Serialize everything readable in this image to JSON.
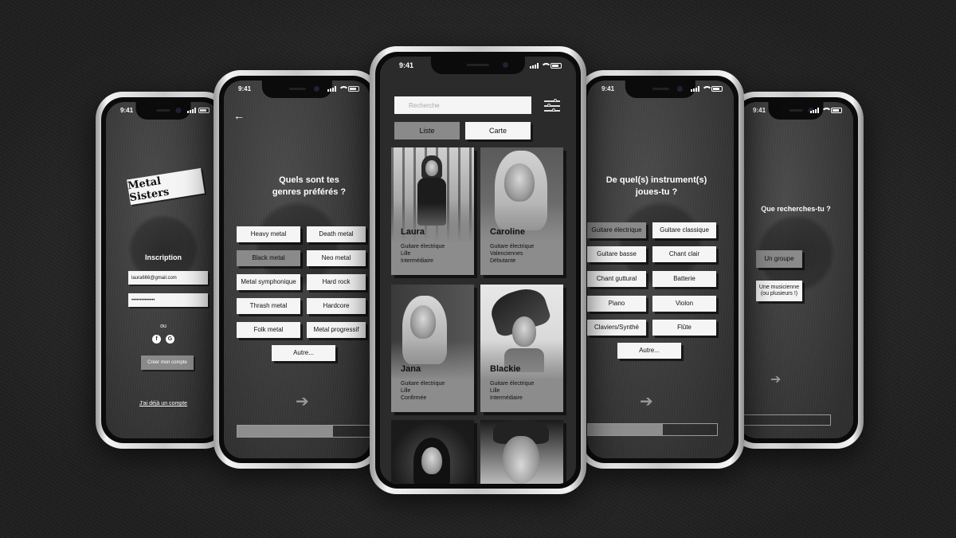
{
  "status_time": "9:41",
  "login": {
    "logo_text": "Metal Sisters",
    "title": "Inscription",
    "email_value": "laura666@gmail.com",
    "password_value": "••••••••••••••",
    "or_label": "ou",
    "social_icons": [
      "facebook-icon",
      "google-icon"
    ],
    "social_glyphs": [
      "f",
      "G"
    ],
    "create_label": "Créer mon compte",
    "already_label": "J'ai déjà un compte"
  },
  "genres": {
    "title_line1": "Quels sont tes",
    "title_line2": "genres préférés ?",
    "options": [
      "Heavy metal",
      "Death metal",
      "Black metal",
      "Neo metal",
      "Metal symphonique",
      "Hard rock",
      "Thrash metal",
      "Hardcore",
      "Folk metal",
      "Metal progressif"
    ],
    "selected": "Black metal",
    "other_label": "Autre...",
    "progress": 0.72
  },
  "list": {
    "search_placeholder": "Recherche",
    "tab_list": "Liste",
    "tab_map": "Carte",
    "active_tab": "Liste",
    "profiles": [
      {
        "name": "Laura",
        "instrument": "Guitare électrique",
        "city": "Lille",
        "level": "Intermédiaire"
      },
      {
        "name": "Caroline",
        "instrument": "Guitare électrique",
        "city": "Valenciennes",
        "level": "Débutante"
      },
      {
        "name": "Jana",
        "instrument": "Guitare électrique",
        "city": "Lille",
        "level": "Confirmée"
      },
      {
        "name": "Blackie",
        "instrument": "Guitare électrique",
        "city": "Lille",
        "level": "Intermédiaire"
      }
    ]
  },
  "instruments": {
    "title_line1": "De quel(s) instrument(s)",
    "title_line2": "joues-tu ?",
    "options": [
      "Guitare électrique",
      "Guitare classique",
      "Guitare basse",
      "Chant clair",
      "Chant guttural",
      "Batterie",
      "Piano",
      "Violon",
      "Claviers/Synthé",
      "Flûte"
    ],
    "selected": "Guitare électrique",
    "other_label": "Autre...",
    "progress": 0.58
  },
  "search_type": {
    "title": "Que recherches-tu ?",
    "option_group": "Un groupe",
    "option_musician_line1": "Une musicienne",
    "option_musician_line2": "(ou plusieurs !)",
    "selected": "Un groupe",
    "progress": 0.08
  }
}
